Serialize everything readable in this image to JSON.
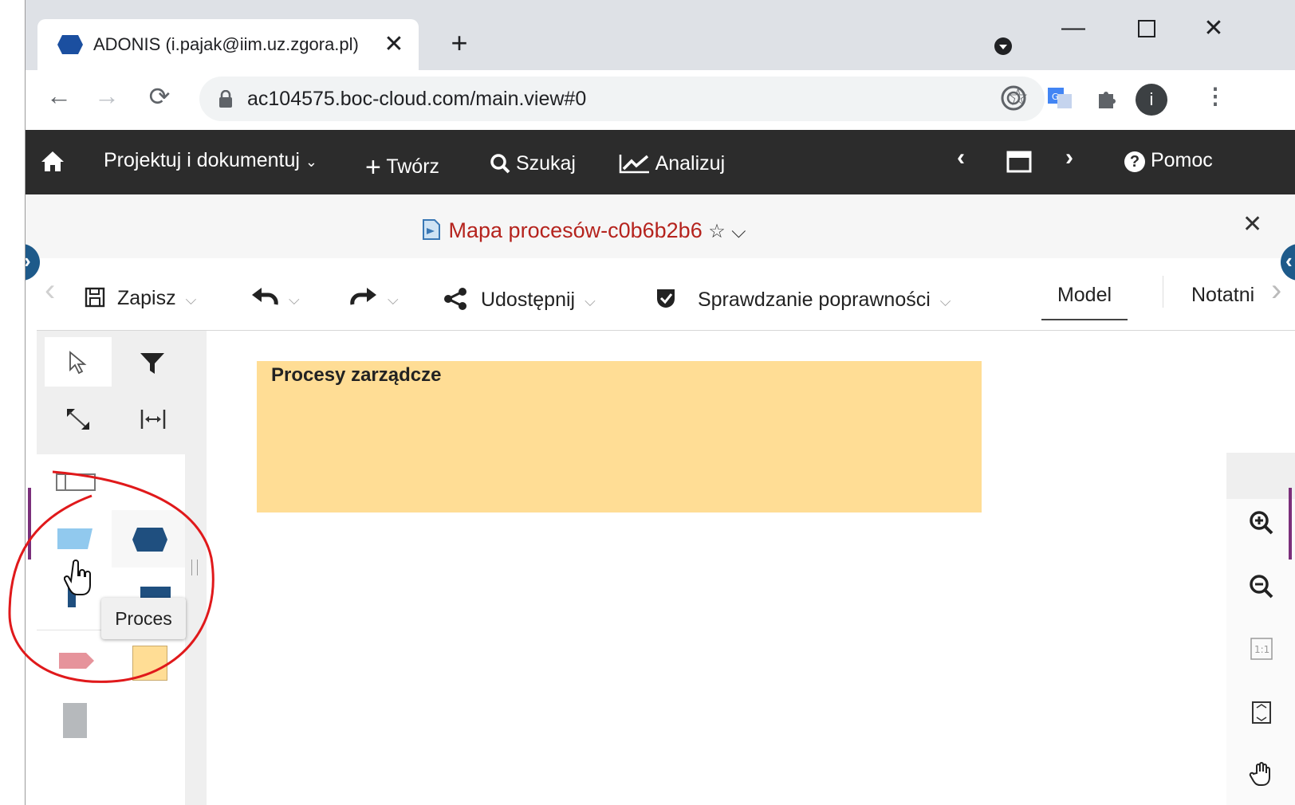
{
  "browser": {
    "tab_title": "ADONIS (i.pajak@iim.uz.zgora.pl)",
    "url": "ac104575.boc-cloud.com/main.view#0",
    "profile_letter": "i"
  },
  "app_nav": {
    "design_menu": "Projektuj i dokumentuj",
    "create": "Twórz",
    "search": "Szukaj",
    "analyze": "Analizuj",
    "help": "Pomoc"
  },
  "document": {
    "title": "Mapa procesów-c0b6b2b6"
  },
  "toolbar": {
    "save": "Zapisz",
    "share": "Udostępnij",
    "validation": "Sprawdzanie poprawności",
    "tab_model": "Model",
    "tab_notebook": "Notatni"
  },
  "canvas": {
    "pool_label": "Procesy zarządcze"
  },
  "tooltip": "Proces",
  "colors": {
    "pool_fill": "#ffdd95",
    "annotation_red": "#e0191b",
    "appbar_bg": "#2c2c2c",
    "title_red": "#b5231d"
  }
}
